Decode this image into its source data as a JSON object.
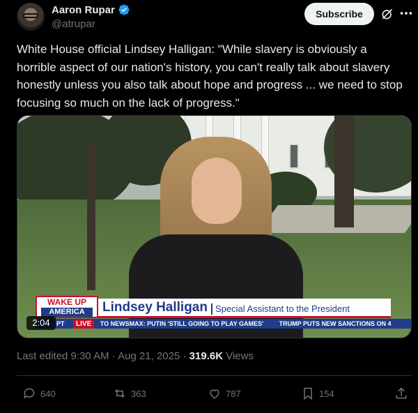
{
  "author": {
    "display_name": "Aaron Rupar",
    "handle": "@atrupar",
    "verified": true
  },
  "header": {
    "subscribe_label": "Subscribe"
  },
  "tweet": {
    "text": "White House official Lindsey Halligan: \"While slavery is obviously a horrible aspect of our nation's history, you can't really talk about slavery honestly unless you also talk about hope and progress ... we need to stop focusing so much on the lack of progress.\""
  },
  "video": {
    "duration": "2:04",
    "logo_top": "WAKE UP",
    "logo_bottom": "AMERICA",
    "strap_name": "Lindsey Halligan",
    "strap_title": "Special Assistant to the President",
    "ticker_pt": "PT",
    "ticker_live": "LIVE",
    "ticker_text_1": "TO NEWSMAX: PUTIN 'STILL GOING TO PLAY GAMES'",
    "ticker_text_2": "TRUMP PUTS NEW SANCTIONS ON 4"
  },
  "meta": {
    "edited": "Last edited 9:30 AM · Aug 21, 2025 · ",
    "views_count": "319.6K",
    "views_label": " Views"
  },
  "actions": {
    "replies": "640",
    "reposts": "363",
    "likes": "787",
    "bookmarks": "154"
  },
  "colors": {
    "background": "#000000",
    "text_primary": "#e7e9ea",
    "text_secondary": "#71767b",
    "verified": "#1d9bf0",
    "newsmax_red": "#c8102e",
    "newsmax_blue": "#1f3c88"
  }
}
